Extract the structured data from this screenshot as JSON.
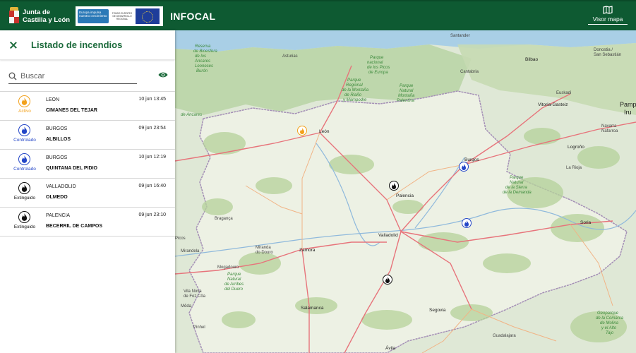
{
  "header": {
    "logo": {
      "line1": "Junta de",
      "line2": "Castilla y León"
    },
    "eu_banner": {
      "impulso": "Europa impulsa nuestro crecimiento",
      "fondo": "FONDO EUROPEO DE DESARROLLO REGIONAL",
      "flag_caption": "UNIÓN EUROPEA"
    },
    "app_title": "INFOCAL",
    "visor_label": "Visor mapa"
  },
  "sidebar": {
    "title": "Listado de incendios",
    "search_placeholder": "Buscar",
    "items": [
      {
        "province": "LEON",
        "date": "10 jun 13:45",
        "place": "CIMANES DEL TEJAR",
        "status": "Activo",
        "status_color": "#f2a11c"
      },
      {
        "province": "BURGOS",
        "date": "09 jun 23:54",
        "place": "ALBILLOS",
        "status": "Controlado",
        "status_color": "#2446c7"
      },
      {
        "province": "BURGOS",
        "date": "10 jun 12:19",
        "place": "QUINTANA DEL PIDIO",
        "status": "Controlado",
        "status_color": "#2446c7"
      },
      {
        "province": "VALLADOLID",
        "date": "09 jun 16:40",
        "place": "OLMEDO",
        "status": "Extinguido",
        "status_color": "#111111"
      },
      {
        "province": "PALENCIA",
        "date": "09 jun 23:10",
        "place": "BECERRIL DE CAMPOS",
        "status": "Extinguido",
        "status_color": "#111111"
      }
    ]
  },
  "map": {
    "labels": {
      "santander": "Santander",
      "bilbao": "Bilbao",
      "donostia": "Donostia /",
      "san_sebastian": "San Sebastián",
      "vitoria": "Vitoria-Gasteiz",
      "pamp": "Pamp",
      "iru": "Iru",
      "navarra": "Navarra",
      "nafarroa": "Nafarroa",
      "logrono": "Logroño",
      "la_rioja": "La Rioja",
      "leon": "León",
      "burgos": "Burgos",
      "palencia": "Palencia",
      "valladolid": "Valladolid",
      "soria": "Soria",
      "zamora": "Zamora",
      "salamanca": "Salamanca",
      "segovia": "Segovia",
      "avila": "Ávila",
      "braganca": "Bragança",
      "mirandela": "Mirandela",
      "mogadouro": "Mogadouro",
      "guadalajara": "Guadalajara",
      "euskadi": "Euskadi",
      "cantabria": "Cantabria",
      "asturias": "Asturias",
      "pinhel": "Pinhel",
      "meda": "Mêda",
      "vila_nova": "Vila Nova",
      "foz_coa": "de Foz Côa",
      "parque_picos_1": "Parque",
      "parque_picos_2": "nacional",
      "parque_picos_3": "de los Picos",
      "parque_picos_4": "de Europa",
      "parque_montana_1": "Parque",
      "parque_montana_2": "Regional",
      "parque_montana_3": "de la Montaña",
      "parque_montana_4": "de Riaño",
      "parque_montana_5": "y Mampodre",
      "parque_fuentes_1": "Parque",
      "parque_fuentes_2": "Natural",
      "parque_fuentes_3": "Montaña",
      "parque_fuentes_4": "Palentina",
      "parque_somiedo_1": "Parque",
      "parque_somiedo_2": "Natural",
      "parque_somiedo_3": "de Arribes",
      "parque_somiedo_4": "del Duero",
      "parque_duero_1": "Parque",
      "parque_duero_2": "Natural",
      "parque_duero_3": "de la Sierra",
      "parque_duero_4": "de la Demanda",
      "parque_guadarrama_1": "Geoparque",
      "parque_guadarrama_2": "de la Comarca",
      "parque_guadarrama_3": "de Molina",
      "parque_guadarrama_4": "y el Alto",
      "parque_guadarrama_5": "Tajo",
      "ancares_1": "Reserva",
      "ancares_2": "de Bioesfera",
      "ancares_3": "de los",
      "ancares_4": "Ancares",
      "ancares_5": "Leoneses",
      "ancares_6": "Burón",
      "leon_ancares": "de Ancares",
      "miranda": "Miranda",
      "do_douro": "do Douro",
      "picos": "Picos"
    }
  }
}
